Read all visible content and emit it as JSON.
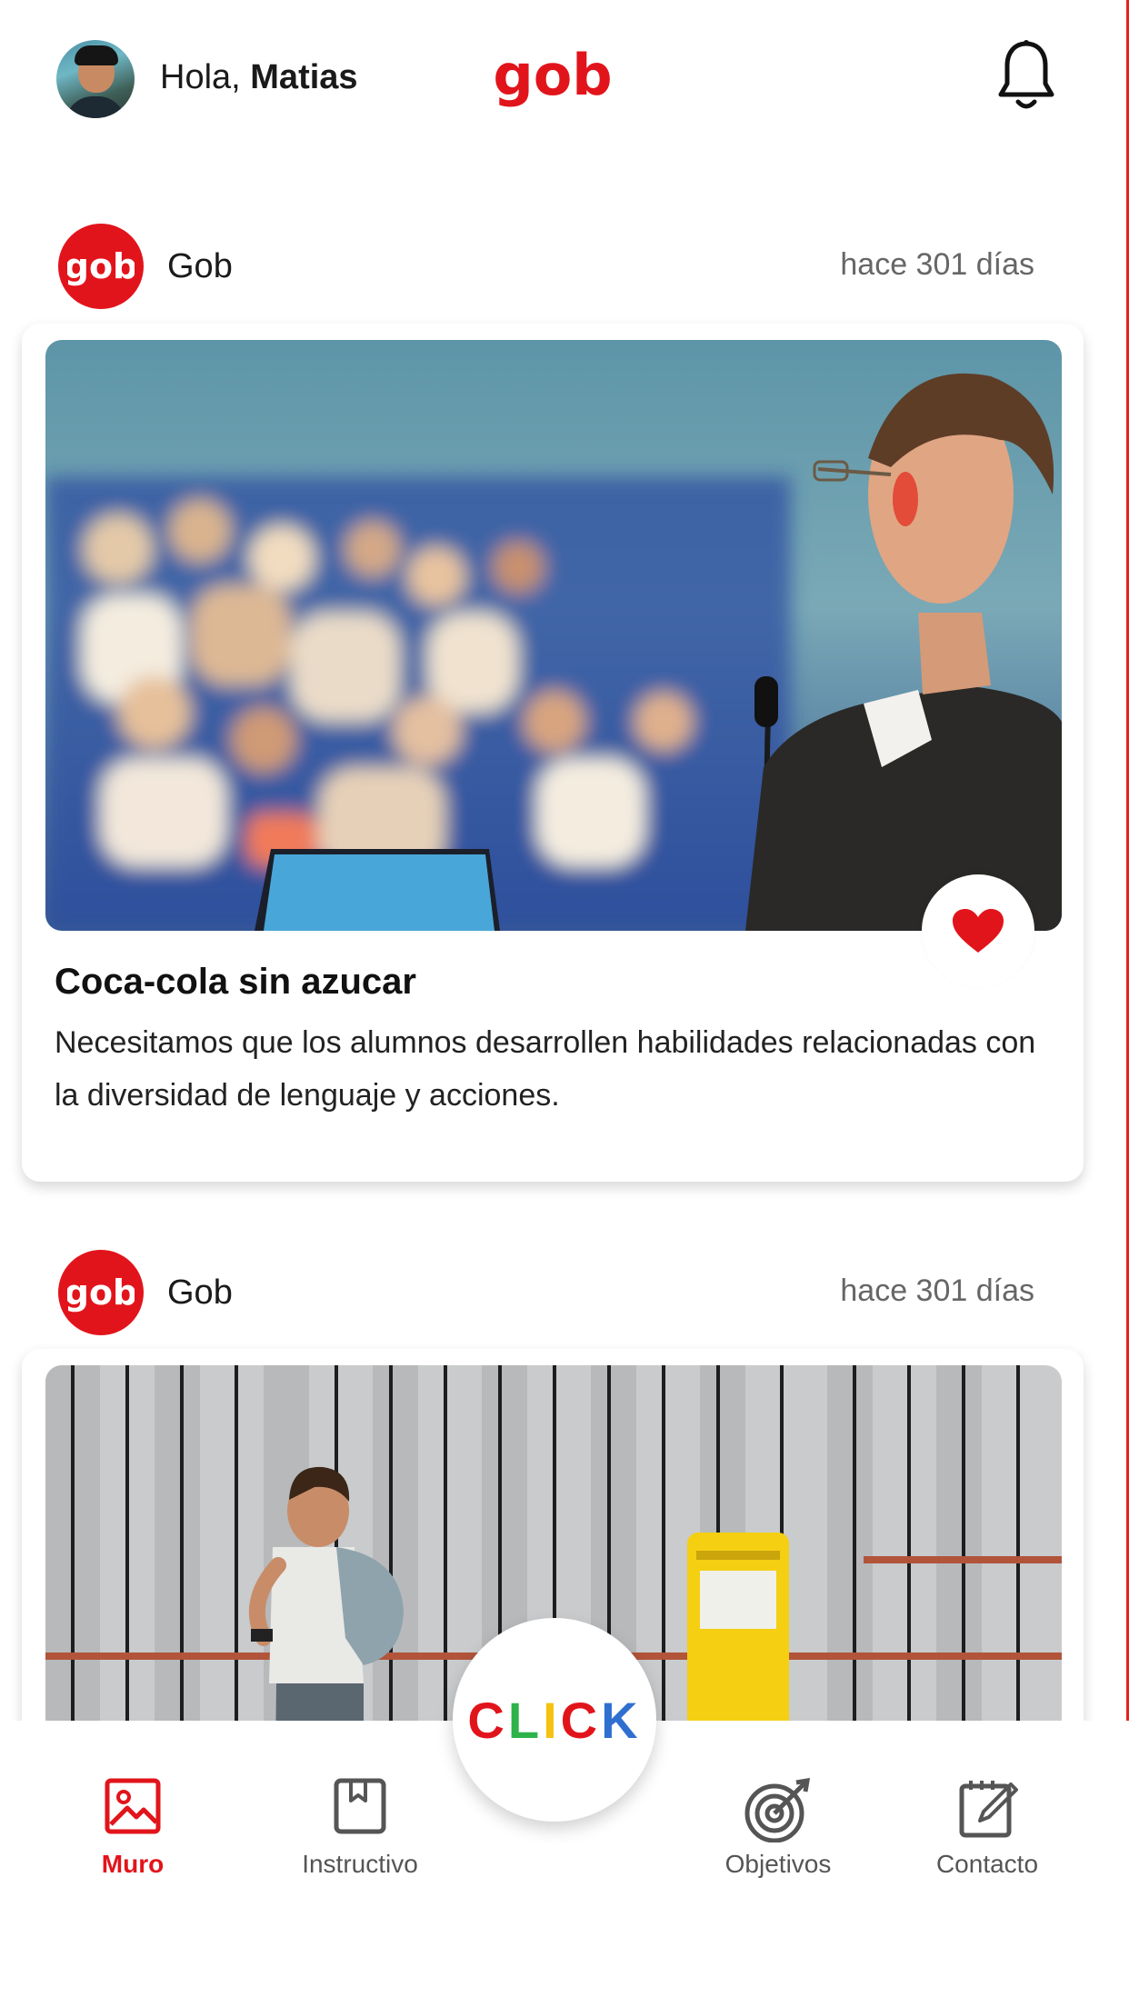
{
  "header": {
    "greeting_prefix": "Hola,",
    "user_name": "Matias",
    "logo_text": "gob"
  },
  "posts": [
    {
      "author": "Gob",
      "time": "hace 301 días",
      "title": "Coca-cola sin azucar",
      "description": "Necesitamos que los alumnos desarrollen habilidades relacionadas con la diversidad de lenguaje y acciones.",
      "liked": true
    },
    {
      "author": "Gob",
      "time": "hace 301 días"
    }
  ],
  "nav": {
    "items": [
      {
        "label": "Muro",
        "icon": "image-icon",
        "active": true
      },
      {
        "label": "Instructivo",
        "icon": "book-icon",
        "active": false
      },
      {
        "label": "Objetivos",
        "icon": "target-icon",
        "active": false
      },
      {
        "label": "Contacto",
        "icon": "note-edit-icon",
        "active": false
      }
    ],
    "center_button": "CLICK"
  },
  "colors": {
    "brand_red": "#e2141b",
    "text": "#111111",
    "muted": "#666666"
  }
}
